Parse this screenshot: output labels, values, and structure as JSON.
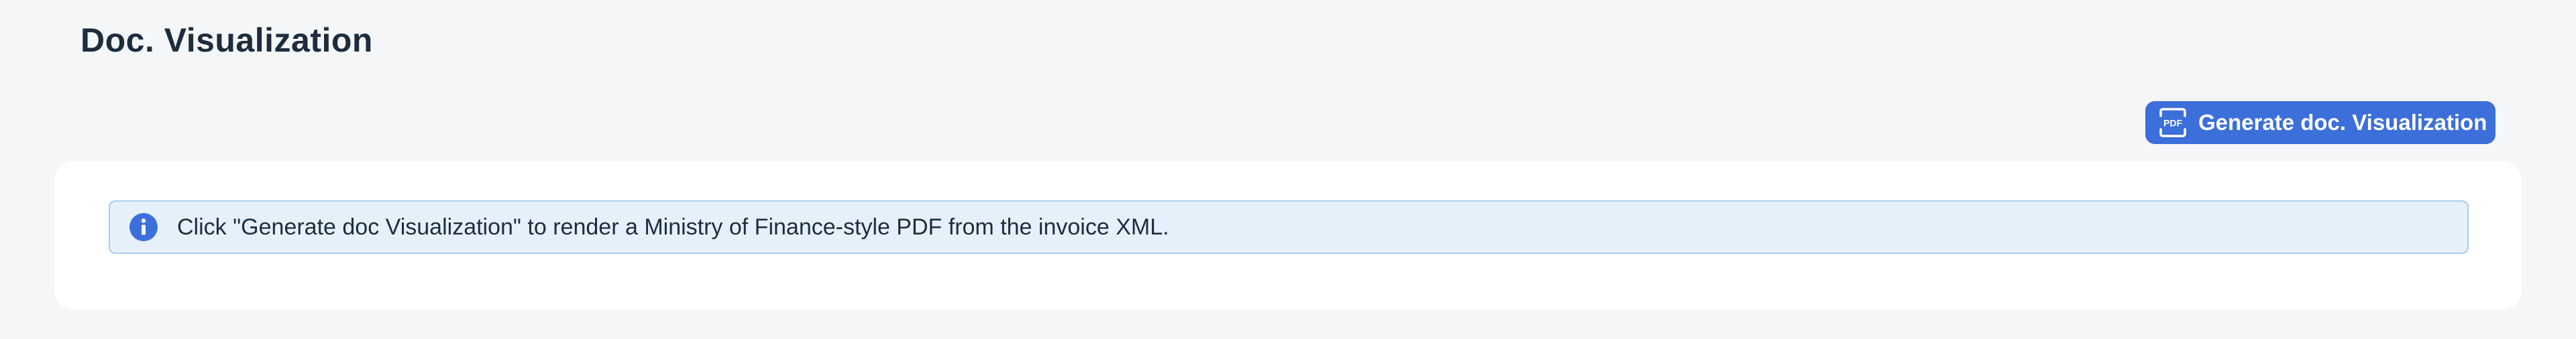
{
  "header": {
    "title": "Doc. Visualization"
  },
  "toolbar": {
    "generate_label": "Generate doc. Visualization",
    "generate_icon": "pdf-icon",
    "generate_icon_text": "PDF"
  },
  "info_strip": {
    "icon": "info-icon",
    "message": "Click \"Generate doc Visualization\" to render a Ministry of Finance-style PDF from the invoice XML."
  },
  "colors": {
    "accent": "#3c6fd9",
    "info_background": "#e5f0fb",
    "info_border": "#a9cdef",
    "page_background": "#f5f6f7"
  }
}
